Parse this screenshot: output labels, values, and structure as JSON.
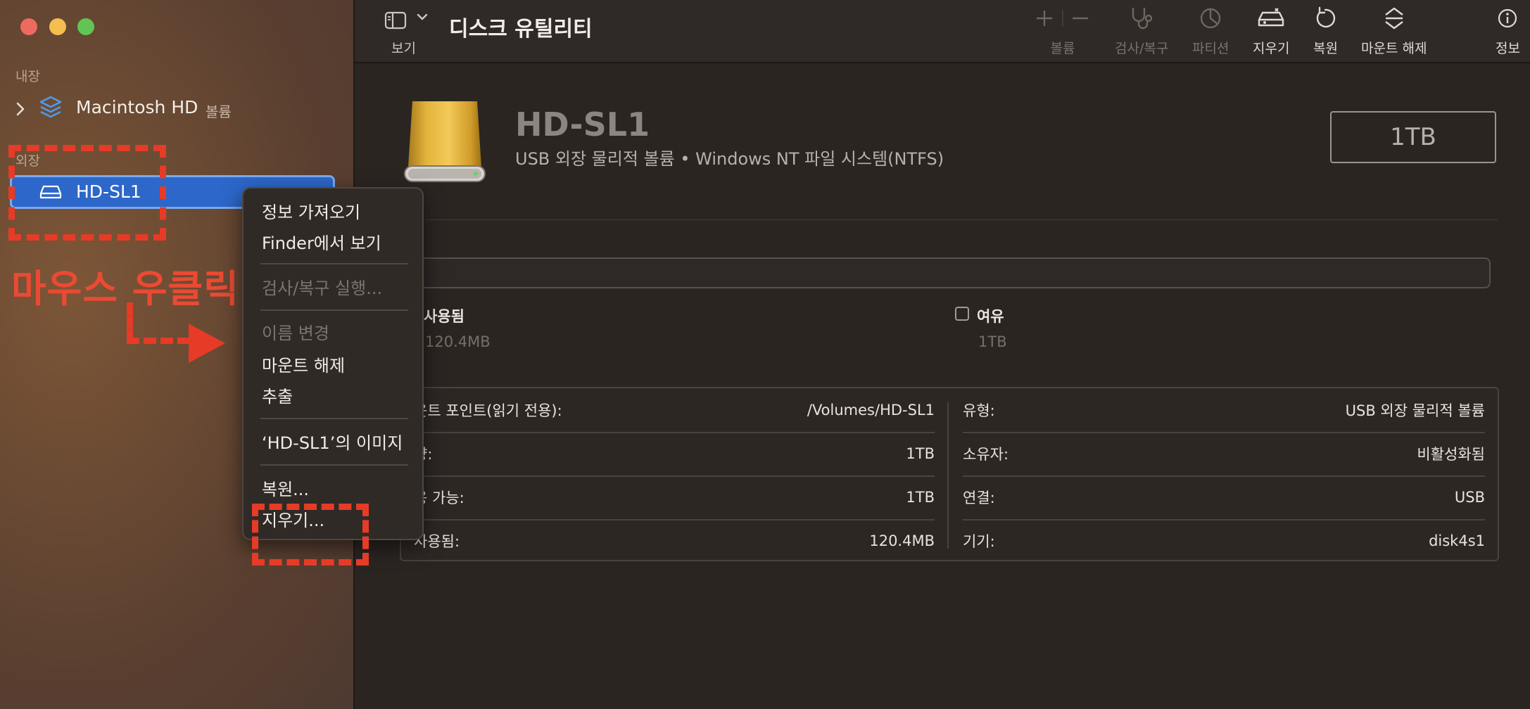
{
  "window": {
    "title": "디스크 유틸리티"
  },
  "sidebar": {
    "section_internal": "내장",
    "section_external": "외장",
    "internal_items": [
      {
        "label": "Macintosh HD",
        "badge": "볼륨",
        "icon": "layers-icon"
      }
    ],
    "external_items": [
      {
        "label": "HD-SL1",
        "icon": "external-drive-icon",
        "selected": true
      }
    ]
  },
  "toolbar": {
    "view_label": "보기",
    "volume_label": "볼륨",
    "first_aid_label": "검사/복구",
    "partition_label": "파티션",
    "erase_label": "지우기",
    "restore_label": "복원",
    "unmount_label": "마운트 해제",
    "info_label": "정보"
  },
  "volume": {
    "name": "HD-SL1",
    "subtitle": "USB 외장 물리적 볼륨 • Windows NT 파일 시스템(NTFS)",
    "size": "1TB"
  },
  "usage": {
    "used_label": "사용됨",
    "used_value": "120.4MB",
    "free_label": "여유",
    "free_value": "1TB",
    "used_fraction": 0.0001
  },
  "info": {
    "left": [
      {
        "key": "운트 포인트(읽기 전용):",
        "value": "/Volumes/HD-SL1"
      },
      {
        "key": "량:",
        "value": "1TB"
      },
      {
        "key": "용 가능:",
        "value": "1TB"
      },
      {
        "key": "사용됨:",
        "value": "120.4MB"
      }
    ],
    "right": [
      {
        "key": "유형:",
        "value": "USB 외장 물리적 볼륨"
      },
      {
        "key": "소유자:",
        "value": "비활성화됨"
      },
      {
        "key": "연결:",
        "value": "USB"
      },
      {
        "key": "기기:",
        "value": "disk4s1"
      }
    ]
  },
  "context_menu": {
    "get_info": "정보 가져오기",
    "show_in_finder": "Finder에서 보기",
    "run_first_aid": "검사/복구 실행...",
    "rename": "이름 변경",
    "unmount": "마운트 해제",
    "eject": "추출",
    "image_of": "‘HD-SL1’의 이미지",
    "restore": "복원...",
    "erase": "지우기..."
  },
  "annotation": {
    "text": "마우스 우클릭",
    "color": "#e63b27"
  },
  "colors": {
    "accent": "#2d67c9",
    "sidebar": "#6a4a33",
    "background": "#2b2522"
  }
}
